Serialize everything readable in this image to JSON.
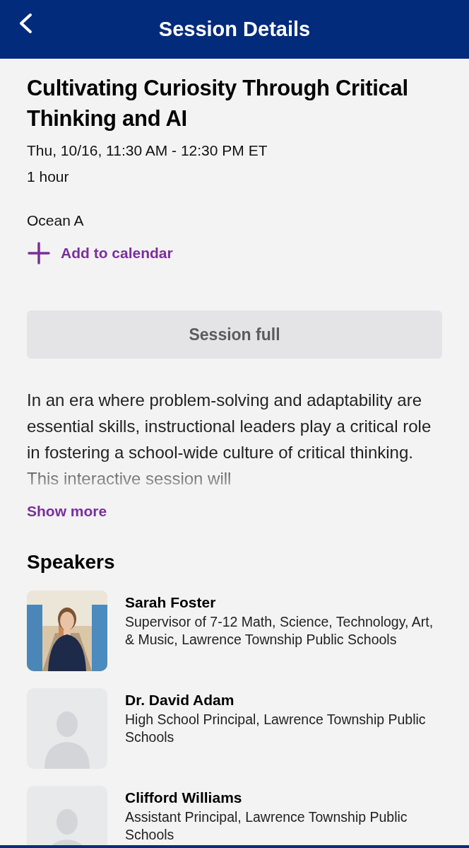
{
  "header": {
    "title": "Session Details"
  },
  "session": {
    "title": "Cultivating Curiosity Through Critical Thinking and AI",
    "time": "Thu, 10/16, 11:30 AM - 12:30 PM ET",
    "duration": "1 hour",
    "location": "Ocean A",
    "add_to_calendar": "Add to calendar",
    "status_button": {
      "label": "Session full",
      "disabled": true
    },
    "description": "In an era where problem-solving and adaptability are essential skills, instructional leaders play a critical role in fostering a school-wide culture of critical thinking. This interactive session will",
    "show_more": "Show more"
  },
  "speakers_heading": "Speakers",
  "speakers": [
    {
      "name": "Sarah Foster",
      "role": "Supervisor of 7-12 Math, Science, Technology, Art, & Music, Lawrence Township Public Schools",
      "kind": "picture"
    },
    {
      "name": "Dr. David Adam",
      "role": "High School Principal, Lawrence Township Public Schools",
      "kind": "placeholder"
    },
    {
      "name": "Clifford Williams",
      "role": "Assistant Principal, Lawrence Township Public Schools",
      "kind": "placeholder"
    }
  ]
}
